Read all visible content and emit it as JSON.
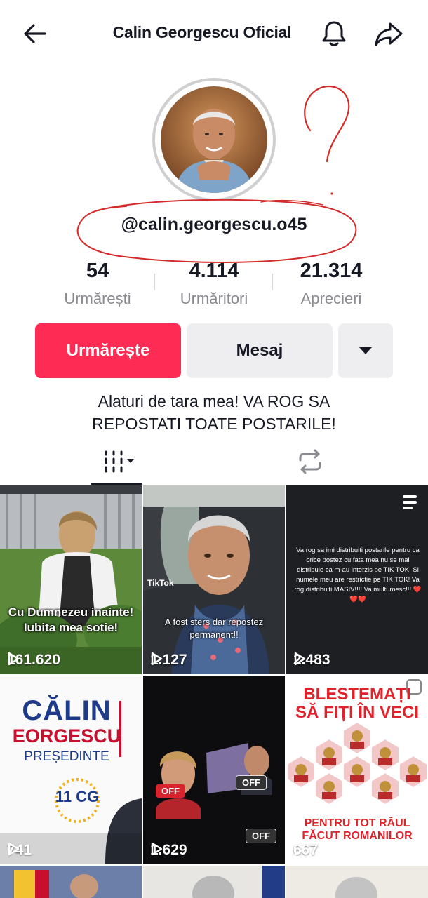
{
  "header": {
    "title": "Calin Georgescu Oficial"
  },
  "profile": {
    "username": "@calin.georgescu.o45",
    "bio": "Alaturi de tara mea! VA ROG SA REPOSTATI TOATE POSTARILE!",
    "bio_line1": "Alaturi de tara mea! VA ROG SA",
    "bio_line2": "REPOSTATI TOATE POSTARILE!"
  },
  "stats": [
    {
      "value": "54",
      "label": "Urmărești"
    },
    {
      "value": "4.114",
      "label": "Urmăritori"
    },
    {
      "value": "21.314",
      "label": "Aprecieri"
    }
  ],
  "actions": {
    "follow_label": "Urmărește",
    "message_label": "Mesaj"
  },
  "grid": [
    {
      "views": "161.620",
      "caption_line1": "Cu Dumnezeu inainte!",
      "caption_line2": "Iubita mea sotie!"
    },
    {
      "views": "1.127",
      "caption_line1": "A fost sters dar repostez",
      "caption_line2": "permanent!!",
      "watermark": "TikTok"
    },
    {
      "views": "2.483",
      "text": "Va rog sa imi distribuiti postarile pentru ca orice postez cu fata mea nu se mai distribuie ca m-au interzis pe TIK TOK! Si numele meu are restrictie pe TIK TOK! Va rog distribuiti MASIV!!!! Va multumesc!!! ❤️❤️❤️"
    },
    {
      "views": "741",
      "name": "CĂLIN",
      "surname": "EORGESCU",
      "role": "PREȘEDINTE",
      "logo": "11 CG"
    },
    {
      "views": "1.629",
      "badge": "OFF"
    },
    {
      "views": "667",
      "title_line1": "BLESTEMAȚI",
      "title_line2": "SĂ FIȚI ÎN VECI",
      "bottom_line1": "PENTRU TOT RĂUL",
      "bottom_line2": "FĂCUT ROMANILOR"
    }
  ],
  "colors": {
    "accent": "#fe2c55",
    "annotation": "#d42a2a",
    "secondary_button": "#eeeef0"
  }
}
